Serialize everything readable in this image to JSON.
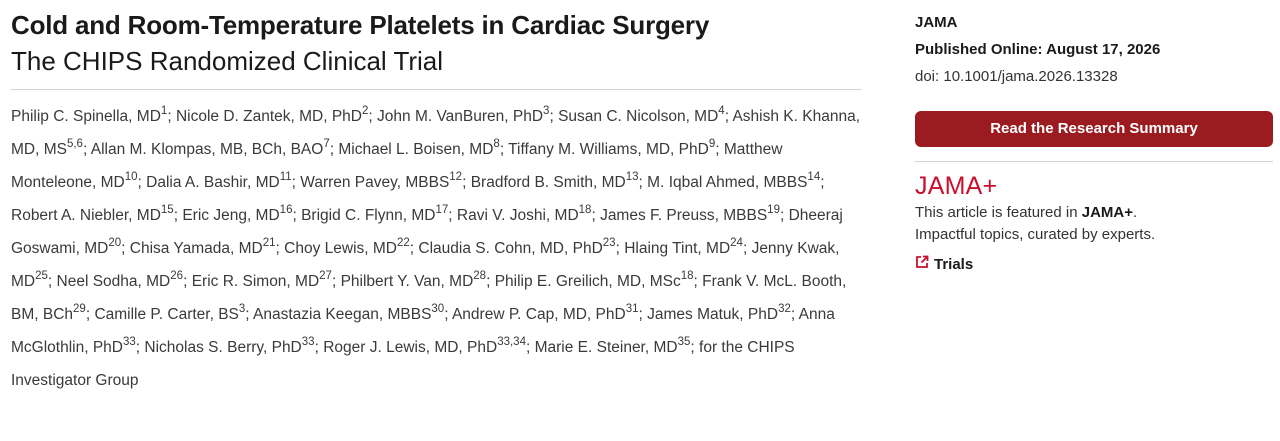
{
  "article": {
    "title": "Cold and Room-Temperature Platelets in Cardiac Surgery",
    "subtitle": "The CHIPS Randomized Clinical Trial",
    "authors": [
      {
        "name": "Philip C. Spinella, MD",
        "aff": "1"
      },
      {
        "name": "Nicole D. Zantek, MD, PhD",
        "aff": "2"
      },
      {
        "name": "John M. VanBuren, PhD",
        "aff": "3"
      },
      {
        "name": "Susan C. Nicolson, MD",
        "aff": "4"
      },
      {
        "name": "Ashish K. Khanna, MD, MS",
        "aff": "5,6"
      },
      {
        "name": "Allan M. Klompas, MB, BCh, BAO",
        "aff": "7"
      },
      {
        "name": "Michael L. Boisen, MD",
        "aff": "8"
      },
      {
        "name": "Tiffany M. Williams, MD, PhD",
        "aff": "9"
      },
      {
        "name": "Matthew Monteleone, MD",
        "aff": "10"
      },
      {
        "name": "Dalia A. Bashir, MD",
        "aff": "11"
      },
      {
        "name": "Warren Pavey, MBBS",
        "aff": "12"
      },
      {
        "name": "Bradford B. Smith, MD",
        "aff": "13"
      },
      {
        "name": "M. Iqbal Ahmed, MBBS",
        "aff": "14"
      },
      {
        "name": "Robert A. Niebler, MD",
        "aff": "15"
      },
      {
        "name": "Eric Jeng, MD",
        "aff": "16"
      },
      {
        "name": "Brigid C. Flynn, MD",
        "aff": "17"
      },
      {
        "name": "Ravi V. Joshi, MD",
        "aff": "18"
      },
      {
        "name": "James F. Preuss, MBBS",
        "aff": "19"
      },
      {
        "name": "Dheeraj Goswami, MD",
        "aff": "20"
      },
      {
        "name": "Chisa Yamada, MD",
        "aff": "21"
      },
      {
        "name": "Choy Lewis, MD",
        "aff": "22"
      },
      {
        "name": "Claudia S. Cohn, MD, PhD",
        "aff": "23"
      },
      {
        "name": "Hlaing Tint, MD",
        "aff": "24"
      },
      {
        "name": "Jenny Kwak, MD",
        "aff": "25"
      },
      {
        "name": "Neel Sodha, MD",
        "aff": "26"
      },
      {
        "name": "Eric R. Simon, MD",
        "aff": "27"
      },
      {
        "name": "Philbert Y. Van, MD",
        "aff": "28"
      },
      {
        "name": "Philip E. Greilich, MD, MSc",
        "aff": "18"
      },
      {
        "name": "Frank V. McL. Booth, BM, BCh",
        "aff": "29"
      },
      {
        "name": "Camille P. Carter, BS",
        "aff": "3"
      },
      {
        "name": "Anastazia Keegan, MBBS",
        "aff": "30"
      },
      {
        "name": "Andrew P. Cap, MD, PhD",
        "aff": "31"
      },
      {
        "name": "James Matuk, PhD",
        "aff": "32"
      },
      {
        "name": "Anna McGlothlin, PhD",
        "aff": "33"
      },
      {
        "name": "Nicholas S. Berry, PhD",
        "aff": "33"
      },
      {
        "name": "Roger J. Lewis, MD, PhD",
        "aff": "33,34"
      },
      {
        "name": "Marie E. Steiner, MD",
        "aff": "35"
      }
    ],
    "group": "for the CHIPS Investigator Group",
    "separator": "; "
  },
  "sidebar": {
    "journal": "JAMA",
    "published": "Published Online: August 17, 2026",
    "doi": "doi: 10.1001/jama.2026.13328",
    "summary_button": "Read the Research Summary",
    "jama_plus": {
      "logo": "JAMA+",
      "featured_prefix": "This article is featured in ",
      "featured_brand": "JAMA+",
      "featured_suffix": ".",
      "tagline": "Impactful topics, curated by experts."
    },
    "topic": {
      "label": "Trials",
      "icon": "external-link-icon"
    }
  },
  "colors": {
    "accent": "#9b1c20",
    "brand": "#c8102e",
    "divider": "#d4d4d4"
  }
}
